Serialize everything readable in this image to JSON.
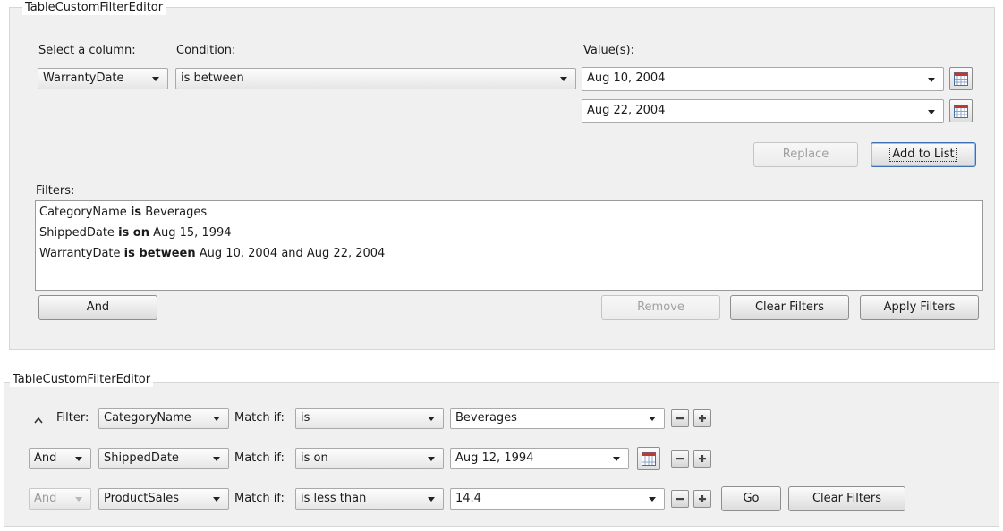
{
  "top_editor": {
    "title": "TableCustomFilterEditor",
    "select_column_label": "Select a column:",
    "condition_label": "Condition:",
    "values_label": "Value(s):",
    "column_value": "WarrantyDate",
    "condition_value": "is between",
    "value1": "Aug 10, 2004",
    "value2": "Aug 22, 2004",
    "replace_label": "Replace",
    "add_to_list_label": "Add to List",
    "filters_label": "Filters:",
    "filters": [
      {
        "column": "CategoryName",
        "op": "is",
        "value": "Beverages"
      },
      {
        "column": "ShippedDate",
        "op": "is on",
        "value": "Aug 15, 1994"
      },
      {
        "column": "WarrantyDate",
        "op": "is between",
        "value": "Aug 10, 2004 and Aug 22, 2004"
      }
    ],
    "and_label": "And",
    "remove_label": "Remove",
    "clear_filters_label": "Clear Filters",
    "apply_filters_label": "Apply Filters"
  },
  "bottom_editor": {
    "title": "TableCustomFilterEditor",
    "rows": [
      {
        "prefix": "Filter:",
        "column": "CategoryName",
        "match_label": "Match if:",
        "condition": "is",
        "value": "Beverages"
      },
      {
        "logic": "And",
        "column": "ShippedDate",
        "match_label": "Match if:",
        "condition": "is on",
        "value": "Aug 12, 1994"
      },
      {
        "logic": "And",
        "column": "ProductSales",
        "match_label": "Match if:",
        "condition": "is less than",
        "value": "14.4"
      }
    ],
    "go_label": "Go",
    "clear_filters_label": "Clear Filters"
  },
  "icons": {
    "calendar": "calendar-icon",
    "minus": "minus-icon",
    "plus": "plus-icon",
    "collapse": "chevron-up-icon",
    "dropdown": "chevron-down-icon"
  },
  "colors": {
    "panel_bg": "#f0f0f0",
    "focus_border": "#3d6fb2"
  }
}
